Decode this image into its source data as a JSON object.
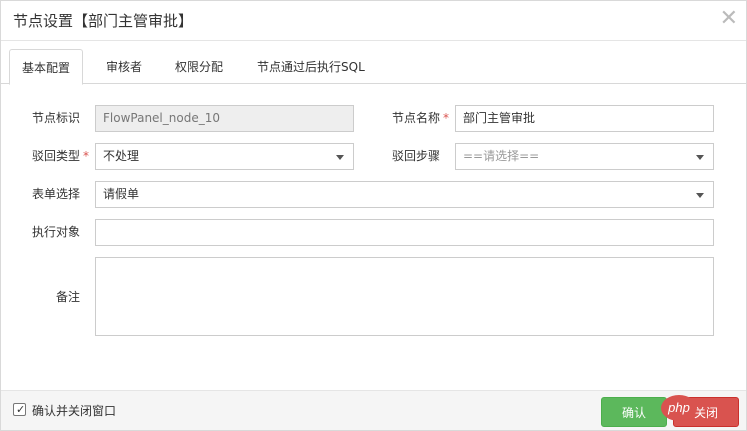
{
  "dialog": {
    "title": "节点设置【部门主管审批】",
    "close_glyph": "✕"
  },
  "tabs": [
    {
      "label": "基本配置",
      "active": true
    },
    {
      "label": "审核者",
      "active": false
    },
    {
      "label": "权限分配",
      "active": false
    },
    {
      "label": "节点通过后执行SQL",
      "active": false
    }
  ],
  "form": {
    "node_id": {
      "label": "节点标识",
      "value": "FlowPanel_node_10"
    },
    "node_name": {
      "label": "节点名称",
      "value": "部门主管审批",
      "required": "*"
    },
    "reject_type": {
      "label": "驳回类型",
      "value": "不处理",
      "required": "*"
    },
    "reject_step": {
      "label": "驳回步骤",
      "value": "==请选择=="
    },
    "form_select": {
      "label": "表单选择",
      "value": "请假单"
    },
    "exec_target": {
      "label": "执行对象",
      "value": ""
    },
    "remark": {
      "label": "备注",
      "value": ""
    }
  },
  "footer": {
    "checkbox_label": "确认并关闭窗口",
    "checked": "✓",
    "confirm_label": "确认",
    "cancel_label": "关闭"
  },
  "watermark": {
    "text": "php"
  }
}
